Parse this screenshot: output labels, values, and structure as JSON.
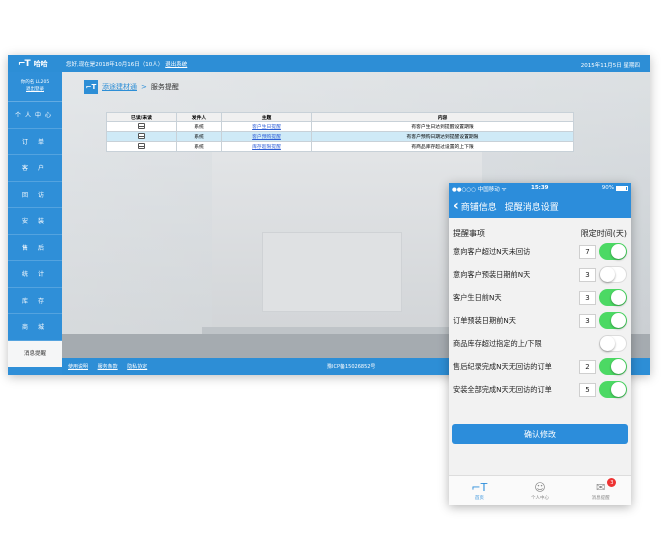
{
  "desktop": {
    "logo_text": "哈哈",
    "welcome": "您好,现在是2018年10月16日（10人）",
    "welcome_link": "退出系统",
    "datetime": "2015年11月5日 星期四",
    "user_name": "你的名 LL205",
    "user_link": "退出登录",
    "nav": [
      "个人中心",
      "订 单",
      "客 户",
      "回 访",
      "安 装",
      "售 后",
      "统 计",
      "库 存",
      "商 城",
      "消息提醒"
    ],
    "breadcrumb": {
      "home": "添途建材通",
      "separator": ">",
      "current": "服务提醒"
    },
    "table": {
      "headers": [
        "已读/未读",
        "发件人",
        "主题",
        "内容"
      ],
      "rows": [
        {
          "sender": "系统",
          "topic": "客户生日提醒",
          "content": "有客户生日达到提醒设置期限"
        },
        {
          "sender": "系统",
          "topic": "客户预购提醒",
          "content": "有客户预购日期达到提醒设置期限"
        },
        {
          "sender": "系统",
          "topic": "库存超限提醒",
          "content": "有商品库存超过设置的上下限"
        }
      ]
    },
    "footer_links": [
      "使用说明",
      "服务条款",
      "隐私协定"
    ],
    "icp": "豫ICP备15026852号"
  },
  "phone": {
    "status": {
      "carrier": "●●○○○ 中国移动 ᯤ",
      "time": "15:39",
      "battery": "90%"
    },
    "nav_back": "商铺信息",
    "nav_title": "提醒消息设置",
    "col_item": "提醒事项",
    "col_time": "限定时间(天)",
    "rows": [
      {
        "label": "意向客户超过N天未回访",
        "days": "7",
        "on": true
      },
      {
        "label": "意向客户预装日期前N天",
        "days": "3",
        "on": false
      },
      {
        "label": "客户生日前N天",
        "days": "3",
        "on": true
      },
      {
        "label": "订单预装日期前N天",
        "days": "3",
        "on": true
      },
      {
        "label": "商品库存超过指定的上/下限",
        "days": "",
        "on": false
      },
      {
        "label": "售后纪录完成N天无回访的订单",
        "days": "2",
        "on": true
      },
      {
        "label": "安装全部完成N天无回访的订单",
        "days": "5",
        "on": true
      }
    ],
    "confirm": "确认修改",
    "tabs": [
      {
        "label": "首页",
        "icon": "home-logo-icon"
      },
      {
        "label": "个人中心",
        "icon": "user-icon"
      },
      {
        "label": "消息提醒",
        "icon": "message-icon",
        "badge": "3"
      }
    ]
  }
}
